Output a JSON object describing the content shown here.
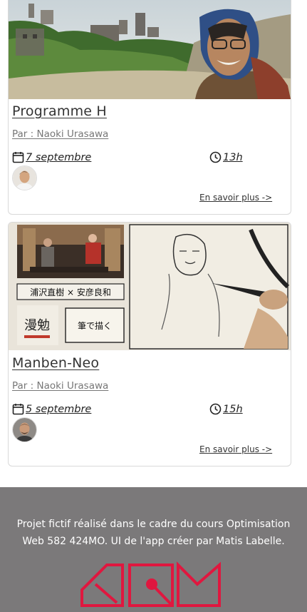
{
  "cards": [
    {
      "title": "Programme H",
      "author": "Par : Naoki Urasawa",
      "date": "7 septembre",
      "time": "13h",
      "more": "En savoir plus ->",
      "image_kind": "photo-ruins-smiling-man",
      "avatar_kind": "author-portrait"
    },
    {
      "title": "Manben-Neo",
      "author": "Par : Naoki Urasawa",
      "date": "5 septembre",
      "time": "15h",
      "more": "En savoir plus ->",
      "image_kind": "tv-show-manga-drawing",
      "avatar_kind": "host-portrait",
      "image_text": {
        "names": "浦沢直樹 × 安彦良和",
        "brand": "漫勉",
        "caption": "筆で描く"
      }
    }
  ],
  "footer": {
    "text": "Projet fictif réalisé dans le cadre du cours Optimisation Web 582 424MO. UI de l'app créer par Matis Labelle.",
    "logo": "AQM-logo",
    "logo_color": "#e0173f",
    "background": "#7b797a"
  },
  "icons": {
    "date": "calendar-icon",
    "time": "clock-icon"
  }
}
